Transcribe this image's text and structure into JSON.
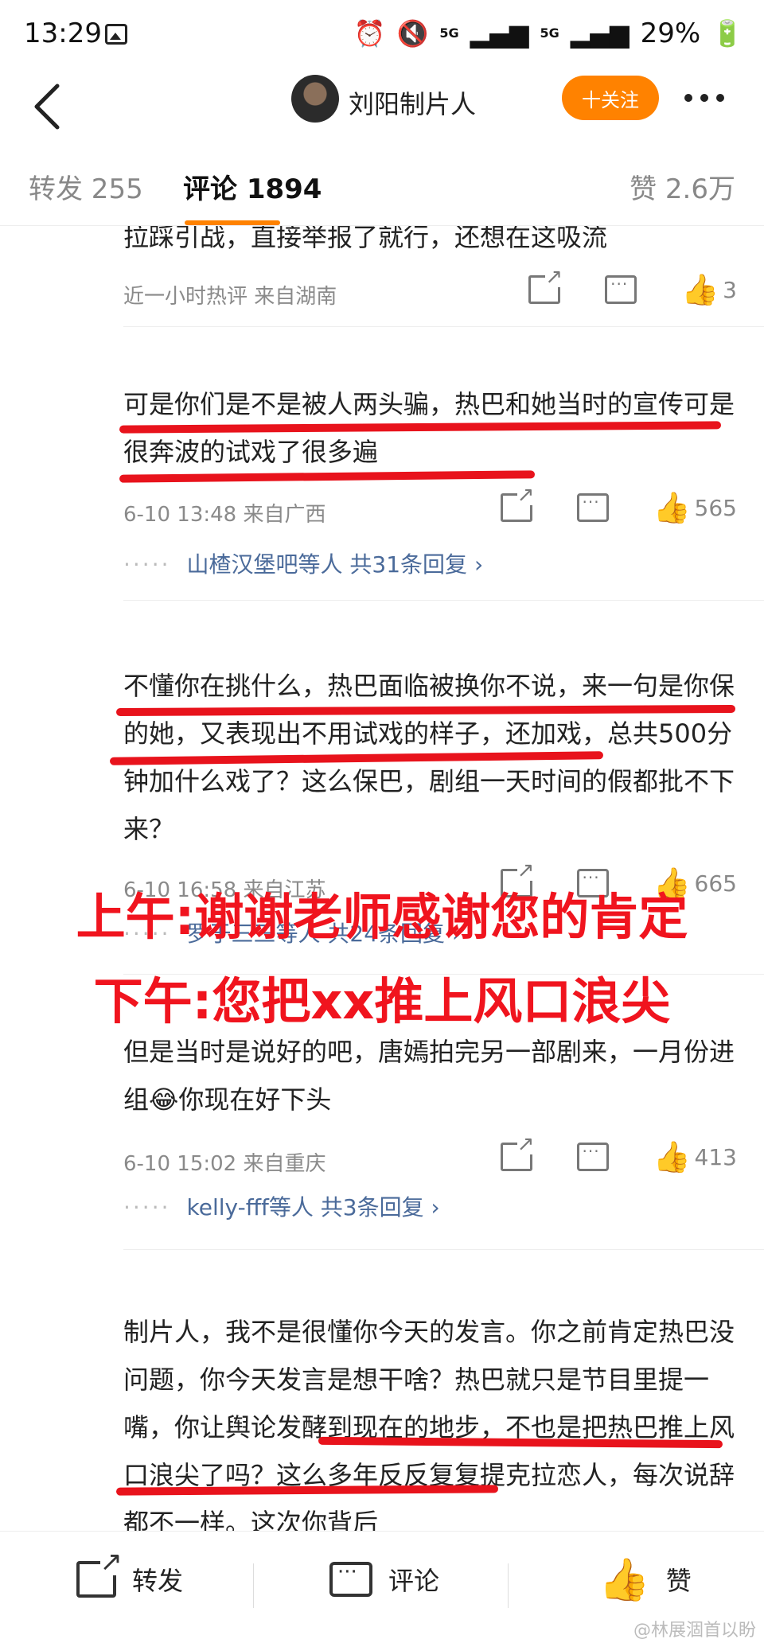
{
  "status_bar": {
    "time": "13:29",
    "net1": "5G",
    "net2": "5G",
    "battery": "29%"
  },
  "nav": {
    "user_name": "刘阳制片人",
    "follow_label": "十关注"
  },
  "tabs": [
    {
      "label": "转发 255"
    },
    {
      "label": "评论 1894"
    },
    {
      "label": "赞 2.6万"
    }
  ],
  "comments": [
    {
      "text": "拉踩引战，直接举报了就行，还想在这吸流",
      "meta": "近一小时热评  来自湖南",
      "likes": "3"
    },
    {
      "text": "可是你们是不是被人两头骗，热巴和她当时的宣传可是很奔波的试戏了很多遍",
      "meta": "6-10 13:48  来自广西",
      "likes": "565",
      "replies": "山楂汉堡吧等人  共31条回复 ›"
    },
    {
      "text": "不懂你在挑什么，热巴面临被换你不说，来一句是你保的她，又表现出不用试戏的样子，还加戏，总共500分钟加什么戏了？这么保巴，剧组一天时间的假都批不下来？",
      "meta": "6-10 16:58  来自江苏",
      "likes": "665",
      "replies": "罗于三三等人  共24条回复 ›"
    },
    {
      "text": "但是当时是说好的吧，唐嫣拍完另一部剧来，一月份进组😂你现在好下头",
      "meta": "6-10 15:02  来自重庆",
      "likes": "413",
      "replies": "kelly-fff等人  共3条回复 ›"
    },
    {
      "text": "制片人，我不是很懂你今天的发言。你之前肯定热巴没问题，你今天发言是想干啥？热巴就只是节目里提一嘴，你让舆论发酵到现在的地步，不也是把热巴推上风口浪尖了吗？这么多年反反复复提克拉恋人，每次说辞都不一样。这次你背后"
    }
  ],
  "overlay": {
    "line1": "上午:谢谢老师感谢您的肯定",
    "line2": "下午:您把xx推上风口浪尖"
  },
  "bottom_bar": {
    "share": "转发",
    "comment": "评论",
    "like": "赞",
    "watermark": "@林展涸首以盼"
  },
  "colors": {
    "accent": "#ff8200",
    "annotation_red": "#e8131c",
    "link_blue": "#4a6a9a"
  }
}
